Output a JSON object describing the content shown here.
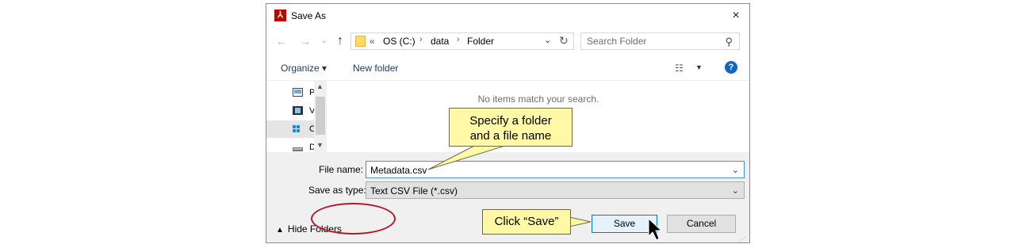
{
  "window": {
    "title": "Save As",
    "app_icon": "pdf-app-icon",
    "close_label": "×"
  },
  "navigation": {
    "back_glyph": "←",
    "forward_glyph": "→",
    "recent_glyph": "⌄",
    "up_glyph": "↑",
    "breadcrumb": {
      "overflow": "«",
      "items": [
        "OS (C:)",
        "data",
        "Folder"
      ],
      "separator": "›"
    },
    "refresh_glyph": "↻",
    "search_placeholder": "Search Folder"
  },
  "toolbar": {
    "organize": "Organize ▾",
    "new_folder": "New folder",
    "view_glyph": "☷",
    "view_dropdown": "▼",
    "help_glyph": "?"
  },
  "nav_pane": {
    "items": [
      {
        "label": "P",
        "icon": "pictures-icon"
      },
      {
        "label": "V",
        "icon": "videos-icon"
      },
      {
        "label": "O",
        "icon": "drive-icon",
        "selected": true
      },
      {
        "label": "D",
        "icon": "drive-icon"
      }
    ]
  },
  "file_pane": {
    "empty_message": "No items match your search."
  },
  "form": {
    "file_name_label": "File name:",
    "file_name_value": "Metadata.csv",
    "save_type_label": "Save as type:",
    "save_type_value": "Text CSV File (*.csv)"
  },
  "footer": {
    "hide_folders": "Hide Folders",
    "save": "Save",
    "cancel": "Cancel"
  },
  "annotations": {
    "callout_folder_line1": "Specify a folder",
    "callout_folder_line2": "and a file name",
    "callout_save": "Click “Save”"
  }
}
